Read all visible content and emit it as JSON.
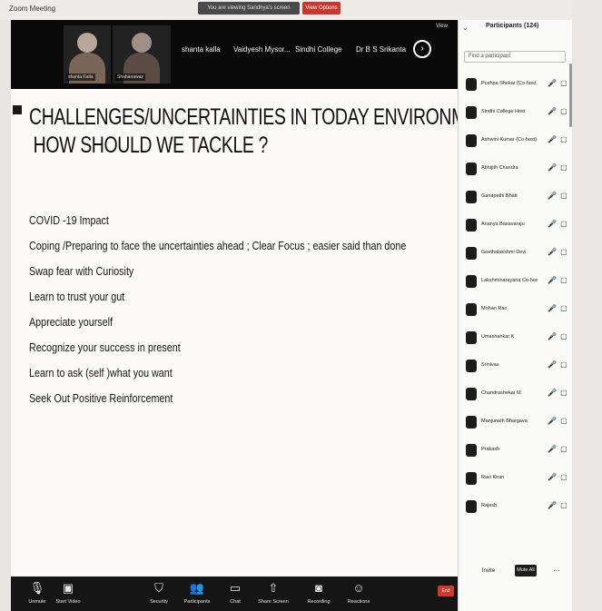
{
  "window": {
    "app_title": "Zoom Meeting",
    "share_banner": "You are viewing Sandhya's screen",
    "stop_share": "View Options"
  },
  "video": {
    "tiles": [
      {
        "label": "shanta Kalla"
      },
      {
        "label": "Shahanawaz"
      }
    ],
    "names": [
      "shanta kalla",
      "Vaidyesh Mysor...",
      "Sindhi College",
      "Dr B S Srikanta"
    ],
    "next_icon": "chevron-right-icon",
    "view_label": "View"
  },
  "slide": {
    "title_line1": "CHALLENGES/UNCERTAINTIES IN TODAY ENVIRONMENT",
    "title_line2": "HOW SHOULD WE TACKLE ?",
    "bullets": [
      "COVID -19 Impact",
      "Coping /Preparing to face the uncertainties ahead ; Clear Focus ; easier said than done",
      "Swap fear with Curiosity",
      "Learn to trust your gut",
      "Appreciate yourself",
      "Recognize your success in present",
      "Learn to ask (self )what you want",
      "Seek Out Positive Reinforcement"
    ]
  },
  "toolbar": {
    "items": [
      {
        "icon": "microphone-icon",
        "label": "Unmute"
      },
      {
        "icon": "video-camera-icon",
        "label": "Start Video"
      },
      {
        "icon": "shield-icon",
        "label": "Security"
      },
      {
        "icon": "participants-icon",
        "label": "Participants"
      },
      {
        "icon": "chat-icon",
        "label": "Chat"
      },
      {
        "icon": "share-screen-icon",
        "label": "Share Screen"
      },
      {
        "icon": "record-icon",
        "label": "Recording"
      },
      {
        "icon": "reactions-icon",
        "label": "Reactions"
      }
    ],
    "end_label": "End"
  },
  "panel": {
    "title": "Participants (124)",
    "search_placeholder": "Find a participant",
    "participants": [
      {
        "name": "Pushpa Shekar (Co-host, me)",
        "status": "🎤 ▢"
      },
      {
        "name": "Sindhi College Host",
        "status": "🎤 ▢"
      },
      {
        "name": "Ashwini Kumar (Co-host)",
        "status": "🎤 ▢"
      },
      {
        "name": "Abhijith Chandra",
        "status": "🎤 ▢"
      },
      {
        "name": "Ganapathi Bhatt",
        "status": "🎤 ▢"
      },
      {
        "name": "Ananya Basavaraju",
        "status": "🎤 ▢"
      },
      {
        "name": "Geethalakshmi Devi",
        "status": "🎤 ▢"
      },
      {
        "name": "Lakshminarayana Co-host",
        "status": "🎤 ▢"
      },
      {
        "name": "Mohan Rao",
        "status": "🎤 ▢"
      },
      {
        "name": "Umashankar K",
        "status": "🎤 ▢"
      },
      {
        "name": "Srinivas",
        "status": "🎤 ▢"
      },
      {
        "name": "Chandrashekar M",
        "status": "🎤 ▢"
      },
      {
        "name": "Manjunath Bhargava",
        "status": "🎤 ▢"
      },
      {
        "name": "Prakash",
        "status": "🎤 ▢"
      },
      {
        "name": "Ravi Kiran",
        "status": "🎤 ▢"
      },
      {
        "name": "Rajesh",
        "status": "🎤 ▢"
      }
    ],
    "invite": "Invite",
    "mute_all": "Mute All",
    "more": "…"
  }
}
